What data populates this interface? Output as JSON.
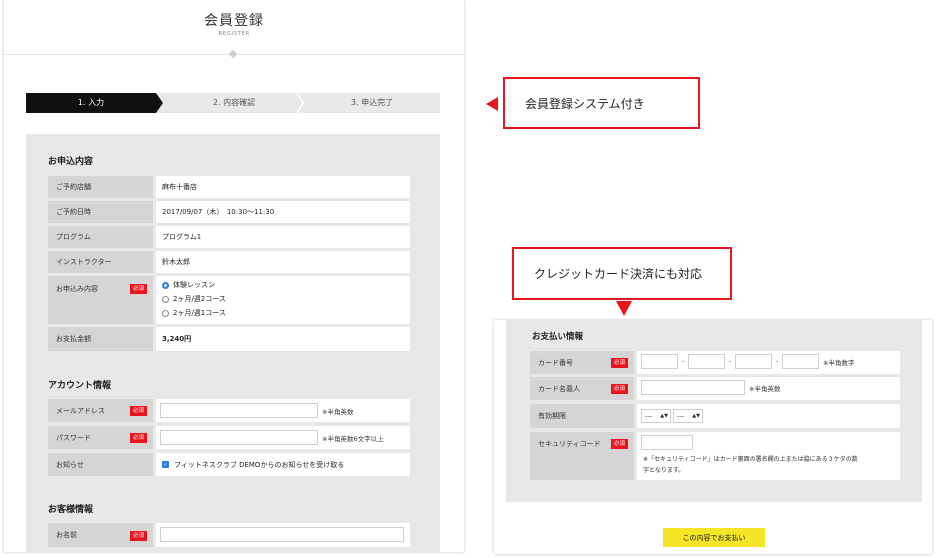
{
  "header": {
    "title": "会員登録",
    "subtitle": "REGISTER"
  },
  "steps": [
    "1. 入力",
    "2. 内容確認",
    "3. 申込完了"
  ],
  "application": {
    "section_title": "お申込内容",
    "rows": [
      {
        "label": "ご予約店舗",
        "value": "麻布十番店"
      },
      {
        "label": "ご予約日時",
        "value": "2017/09/07（木）　10:30〜11:30"
      },
      {
        "label": "プログラム",
        "value": "プログラム1"
      },
      {
        "label": "インストラクター",
        "value": "鈴木太郎"
      }
    ],
    "content_label": "お申込み内容",
    "options": [
      "体験レッスン",
      "2ヶ月/週2コース",
      "2ヶ月/週1コース"
    ],
    "selected_option": "体験レッスン",
    "amount_label": "お支払金額",
    "amount_value": "3,240円"
  },
  "required_badge": "必須",
  "account": {
    "section_title": "アカウント情報",
    "email_label": "メールアドレス",
    "email_hint": "※半角英数",
    "password_label": "パスワード",
    "password_hint": "※半角英数6文字以上",
    "notice_label": "お知らせ",
    "notice_text": "フィットネスクラブ DEMOからのお知らせを受け取る",
    "notice_checked": true
  },
  "customer": {
    "section_title": "お客様情報",
    "name_label": "お名前"
  },
  "callouts": {
    "membership": "会員登録システム付き",
    "credit": "クレジットカード決済にも対応"
  },
  "payment": {
    "section_title": "お支払い情報",
    "card_number_label": "カード番号",
    "card_number_sep": "-",
    "card_number_hint": "※半角数字",
    "card_name_label": "カード名義人",
    "card_name_hint": "※半角英数",
    "expiry_label": "有効期限",
    "expiry_month": "---",
    "expiry_year": "---",
    "security_label": "セキュリティコード",
    "security_note_1": "※「セキュリティコード」はカード裏面の署名欄の上または脇にある３ケタの数",
    "security_note_2": "字となります。",
    "submit_label": "この内容でお支払い"
  },
  "colors": {
    "accent_red": "#e8141e",
    "active_step": "#111111",
    "submit_yellow": "#f4e527",
    "label_gray": "#d5d5d5",
    "panel_gray": "#e8e8e8"
  }
}
